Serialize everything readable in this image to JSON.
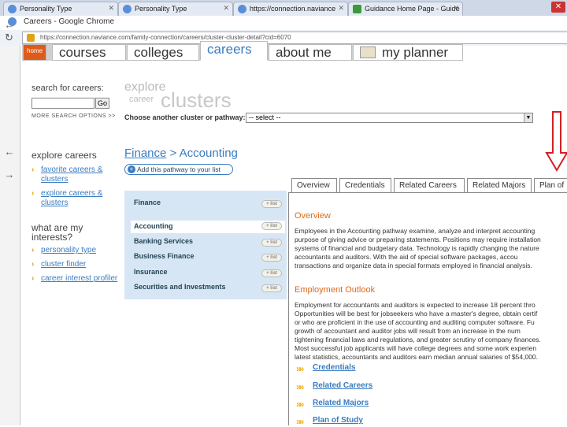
{
  "browser": {
    "tabs": [
      {
        "label": "Personality Type",
        "active": false
      },
      {
        "label": "Careers - Google Chrome",
        "active": true
      },
      {
        "label": "Personality Type",
        "active": false
      },
      {
        "label": "https://connection.naviance",
        "active": false
      },
      {
        "label": "Guidance Home Page - Guide",
        "active": false
      }
    ],
    "window_title": "Careers - Google Chrome",
    "url": "https://connection.naviance.com/family-connection/careers/cluster-cluster-detail?cid=6070"
  },
  "nav": {
    "home": "home",
    "items": [
      "courses",
      "colleges",
      "careers",
      "about me",
      "my planner"
    ]
  },
  "left": {
    "search_label": "search for careers:",
    "go_label": "Go",
    "more_search": "MORE SEARCH OPTIONS >>",
    "explore_heading": "explore careers",
    "explore_links": [
      "favorite careers & clusters",
      "explore careers & clusters"
    ],
    "interests_heading": "what are my interests?",
    "interest_links": [
      "personality type",
      "cluster finder",
      "career interest profiler"
    ]
  },
  "clusters": {
    "logo_explore": "explore",
    "logo_career": "career",
    "logo_clusters": "clusters",
    "choose_label": "Choose another cluster or pathway:",
    "select_value": "-- select --",
    "breadcrumb_cluster": "Finance",
    "breadcrumb_sep": " > ",
    "breadcrumb_pathway": "Accounting",
    "add_pathway": "Add this pathway to your list"
  },
  "pathways": [
    {
      "name": "Finance",
      "pill": "+ list",
      "selected": false
    },
    {
      "name": "Accounting",
      "pill": "+ list",
      "selected": true
    },
    {
      "name": "Banking Services",
      "pill": "+ list",
      "selected": false
    },
    {
      "name": "Business Finance",
      "pill": "+ list",
      "selected": false
    },
    {
      "name": "Insurance",
      "pill": "+ list",
      "selected": false
    },
    {
      "name": "Securities and Investments",
      "pill": "+ list",
      "selected": false
    }
  ],
  "content_tabs": [
    "Overview",
    "Credentials",
    "Related Careers",
    "Related Majors",
    "Plan of"
  ],
  "content": {
    "overview_title": "Overview",
    "overview_lines": [
      "Employees in the Accounting pathway examine, analyze and interpret accounting",
      "purpose of giving advice or preparing statements. Positions may require installation",
      "systems of financial and budgetary data. Technology is rapidly changing the nature",
      "accountants and auditors. With the aid of special software packages, accou",
      "transactions and organize data in special formats employed in financial analysis."
    ],
    "outlook_title": "Employment Outlook",
    "outlook_lines": [
      "Employment for accountants and auditors is expected to increase 18 percent thro",
      "Opportunities will be best for jobseekers who have a master's degree, obtain certif",
      "or who are proficient in the use of accounting and auditing computer software. Fu",
      "growth of accountant and auditor jobs will result from an increase in the num",
      "tightening financial laws and regulations, and greater scrutiny of company finances.",
      "Most successful job applicants will have college degrees and some work experien",
      "latest statistics, accountants and auditors earn median annual salaries of $54,000."
    ],
    "links": [
      "Credentials",
      "Related Careers",
      "Related Majors",
      "Plan of Study"
    ]
  }
}
